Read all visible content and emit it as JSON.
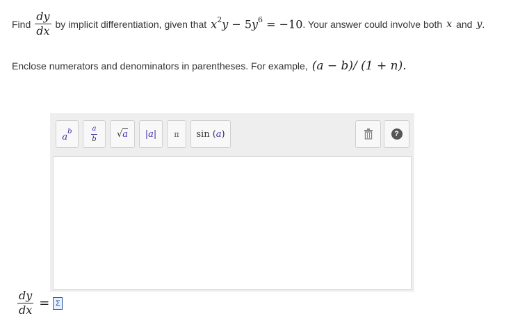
{
  "question": {
    "find": "Find",
    "dy": "dy",
    "dx": "dx",
    "by_text": "by implicit differentiation, given that",
    "x": "x",
    "exp2": "2",
    "y": "y",
    "minus": " − ",
    "coef": "5",
    "exp6": "6",
    "equals": " = ",
    "rhs": "−10",
    "after_eq": ". Your answer could involve both",
    "and_text": "and",
    "period": "."
  },
  "hint": {
    "text": "Enclose numerators and denominators in parentheses. For example,",
    "example": "(a − b)/ (1 + n)."
  },
  "toolbar": {
    "power_base": "a",
    "power_exp": "b",
    "frac_num": "a",
    "frac_den": "b",
    "sqrt_symbol": "√",
    "sqrt_arg": "a",
    "abs_label": "|a|",
    "pi_label": "π",
    "sin_func": "sin",
    "sin_arg": "a",
    "help_label": "?",
    "trash_icon": "trash-icon"
  },
  "answer": {
    "dy": "dy",
    "dx": "dx",
    "equals": "=",
    "sum_icon": "Σ"
  }
}
